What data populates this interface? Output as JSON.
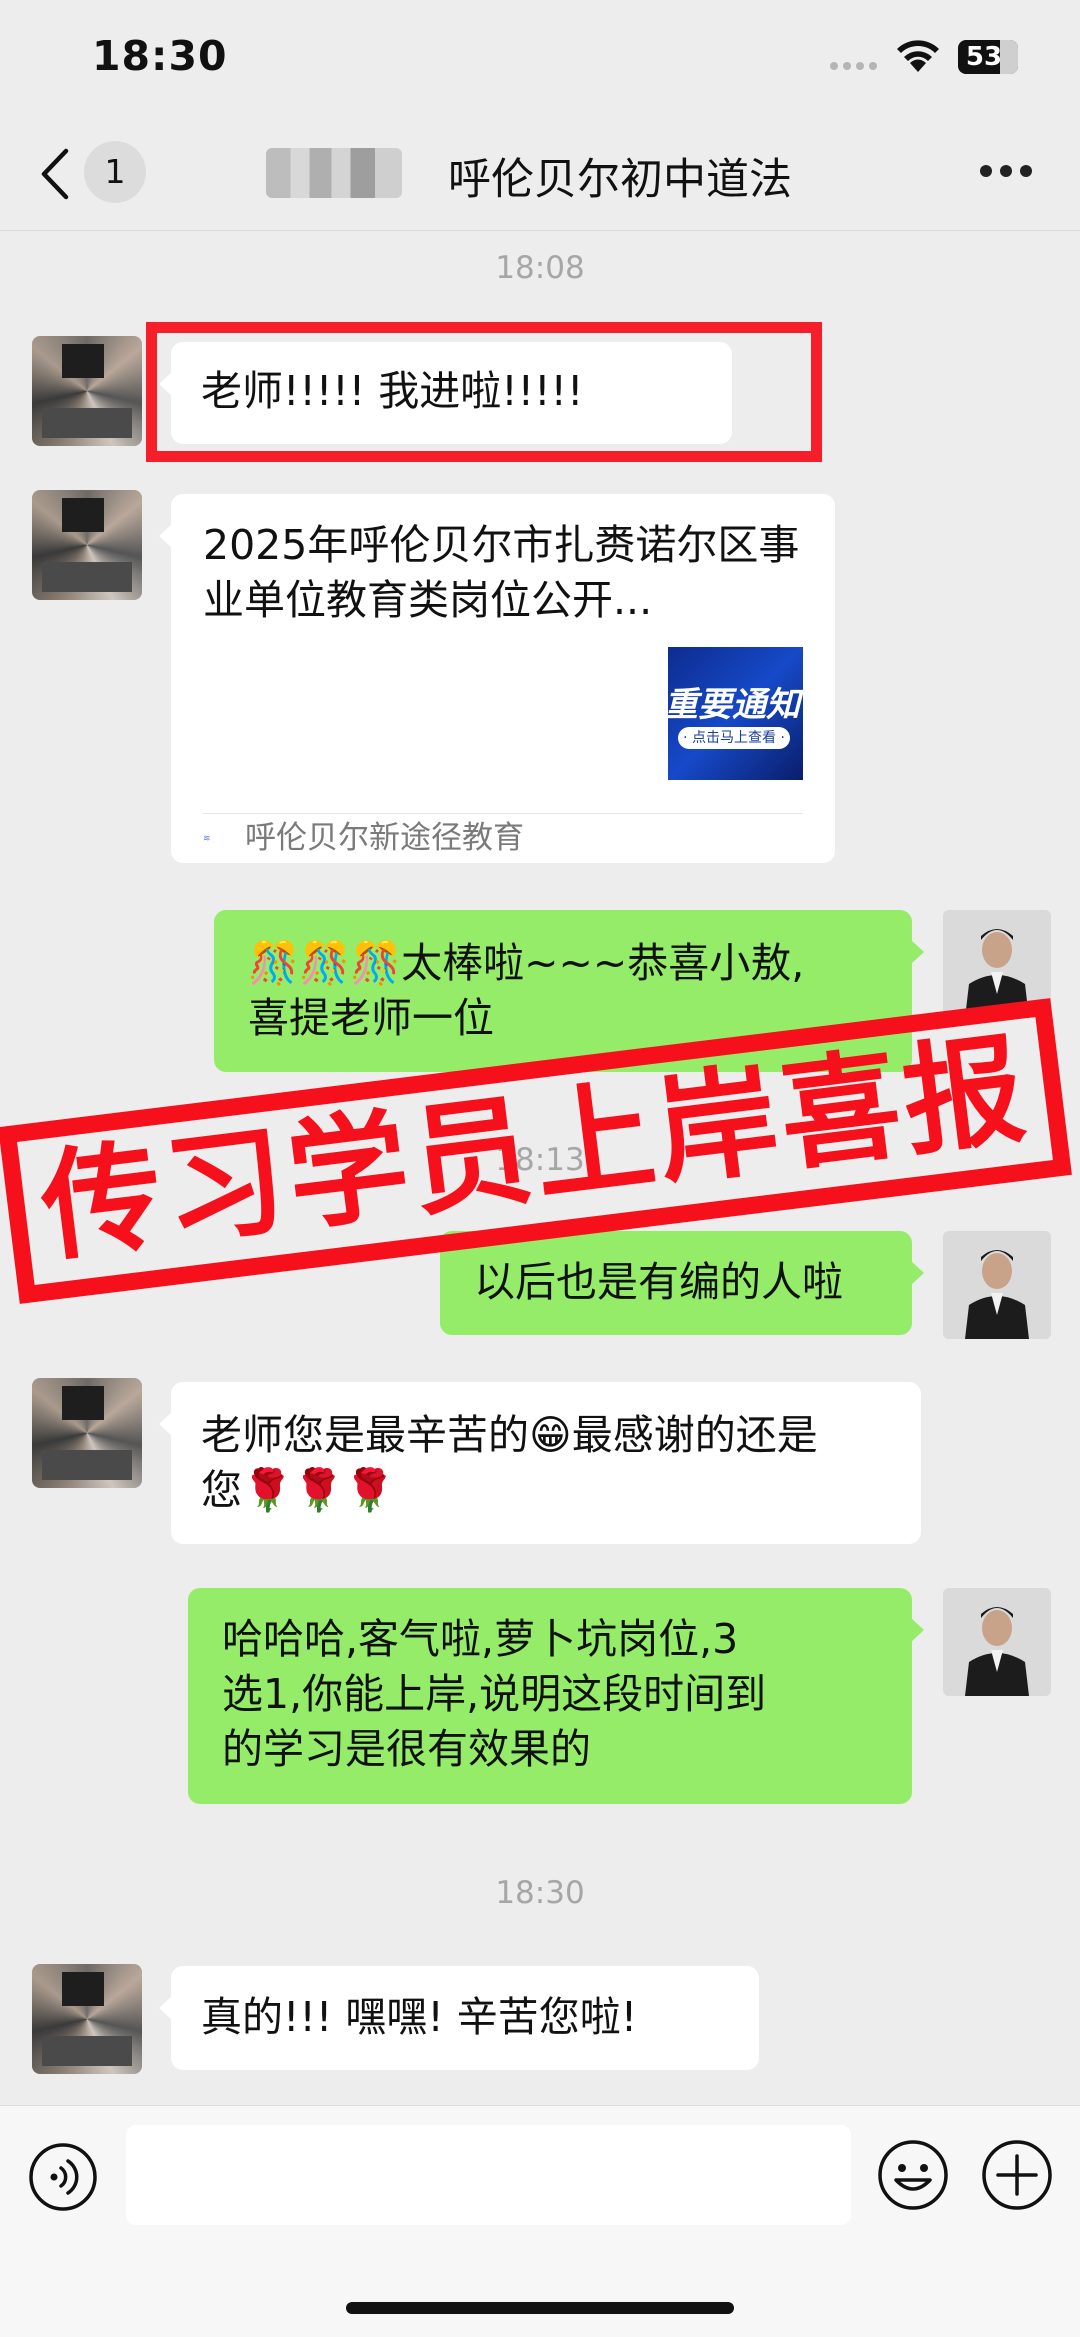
{
  "status_bar": {
    "time": "18:30",
    "battery": "53"
  },
  "nav": {
    "unread_count": "1",
    "title": "呼伦贝尔初中道法"
  },
  "messages": {
    "time_1": "18:08",
    "m1": "老师!!!!! 我进啦!!!!!",
    "card": {
      "title": "2025年呼伦贝尔市扎赉诺尔区事业单位教育类岗位公开...",
      "thumb_main": "重要通知",
      "thumb_sub": "· 点击马上查看 ·",
      "source": "呼伦贝尔新途径教育"
    },
    "m2": [
      "🎊🎊🎊太棒啦~~~恭喜小敖,",
      "喜提老师一位"
    ],
    "time_2": "18:13",
    "m3": "以后也是有编的人啦",
    "m4": [
      "老师您是最辛苦的😁最感谢的还是",
      "您🌹🌹🌹"
    ],
    "m5": [
      "哈哈哈,客气啦,萝卜坑岗位,3",
      "选1,你能上岸,说明这段时间到",
      "的学习是很有效果的"
    ],
    "time_3": "18:30",
    "m6": "真的!!! 嘿嘿! 辛苦您啦!"
  },
  "stamp_text": "传习学员上岸喜报",
  "colors": {
    "green_bubble": "#95EC69",
    "stamp_red": "#F5101C",
    "background": "#EDEDED"
  },
  "icons": [
    "back-chevron-icon",
    "more-icon",
    "voice-icon",
    "emoji-icon",
    "plus-icon",
    "wifi-icon",
    "signal-icon",
    "battery-icon"
  ]
}
